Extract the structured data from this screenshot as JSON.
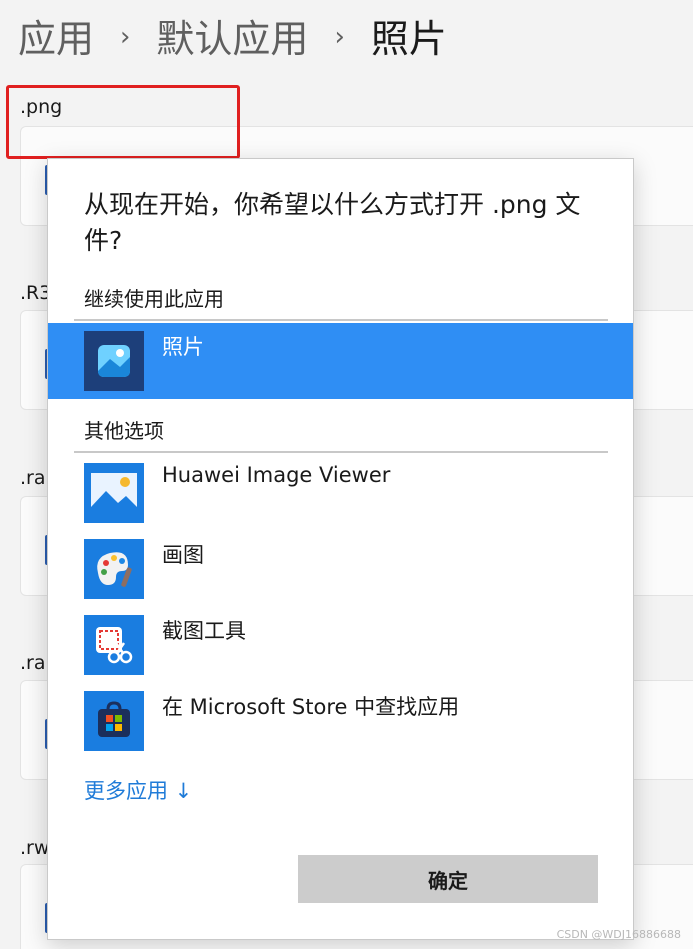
{
  "breadcrumb": {
    "items": [
      "应用",
      "默认应用",
      "照片"
    ],
    "separator": "›"
  },
  "background_list": {
    "extensions": [
      ".png",
      ".R3",
      ".ra",
      ".ra",
      ".rw"
    ]
  },
  "dialog": {
    "title": "从现在开始，你希望以什么方式打开 .png 文件?",
    "section_current": "继续使用此应用",
    "current_app": {
      "name": "照片",
      "icon": "photos-icon",
      "selected": true
    },
    "section_other": "其他选项",
    "other_apps": [
      {
        "name": "Huawei Image Viewer",
        "icon": "huawei-image-viewer-icon"
      },
      {
        "name": "画图",
        "icon": "paint-icon"
      },
      {
        "name": "截图工具",
        "icon": "snipping-tool-icon"
      },
      {
        "name": "在 Microsoft Store 中查找应用",
        "icon": "microsoft-store-icon"
      }
    ],
    "more_apps_label": "更多应用 ↓",
    "ok_label": "确定"
  },
  "colors": {
    "accent": "#2f8ef4",
    "link": "#1f7bd8",
    "highlight_box": "#e02020"
  },
  "watermark": "CSDN @WDJ16886688"
}
